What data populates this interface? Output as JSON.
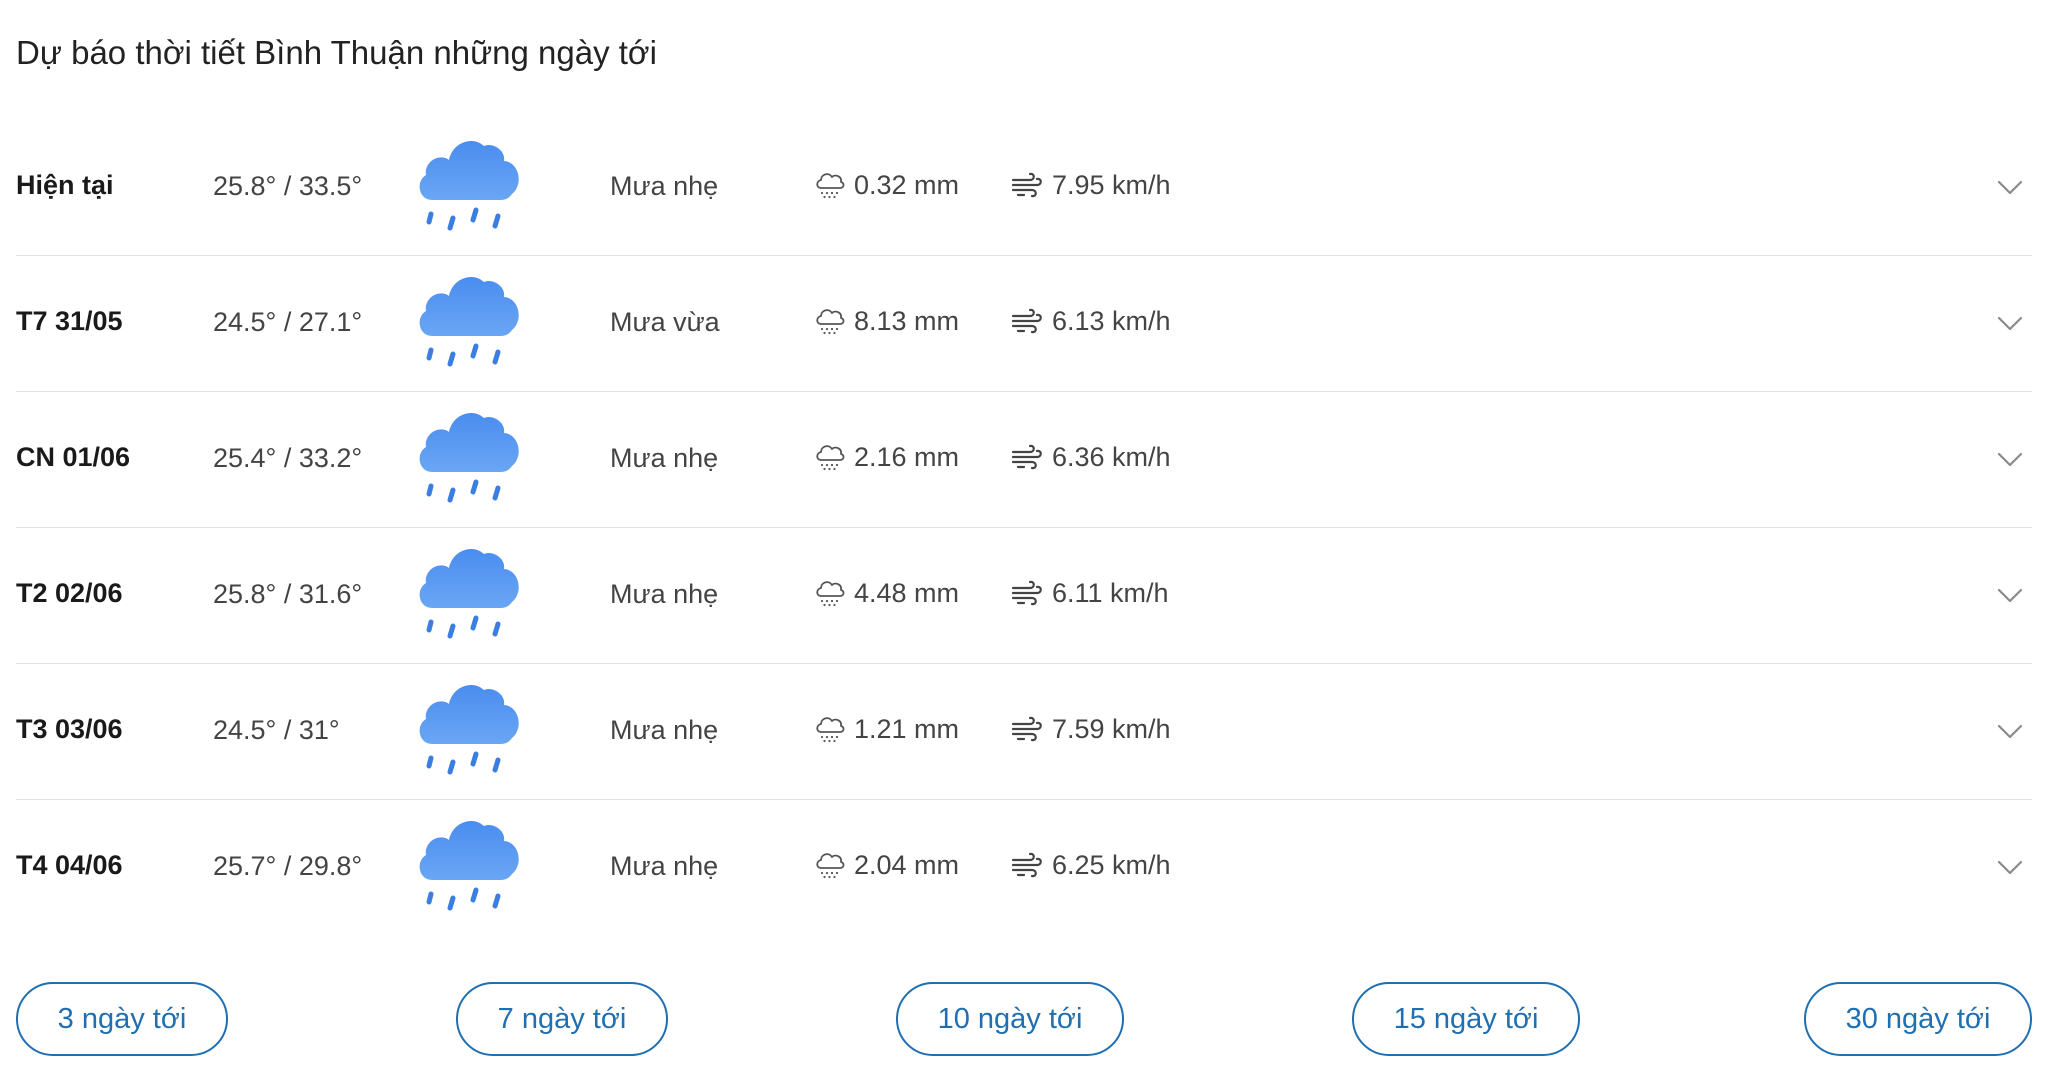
{
  "page": {
    "title": "Dự báo thời tiết Bình Thuận những ngày tới"
  },
  "colors": {
    "accent": "#1f6fb2",
    "cloud": "#5a98f2",
    "rain_drop": "#3b7de0",
    "divider": "#e2e2e2"
  },
  "forecast": [
    {
      "day": "Hiện tại",
      "temp": "25.8° / 33.5°",
      "condition": "Mưa nhẹ",
      "rain": "0.32 mm",
      "wind": "7.95 km/h",
      "icon": "rain-cloud-icon"
    },
    {
      "day": "T7 31/05",
      "temp": "24.5° / 27.1°",
      "condition": "Mưa vừa",
      "rain": "8.13 mm",
      "wind": "6.13 km/h",
      "icon": "rain-cloud-icon"
    },
    {
      "day": "CN 01/06",
      "temp": "25.4° / 33.2°",
      "condition": "Mưa nhẹ",
      "rain": "2.16 mm",
      "wind": "6.36 km/h",
      "icon": "rain-cloud-icon"
    },
    {
      "day": "T2 02/06",
      "temp": "25.8° / 31.6°",
      "condition": "Mưa nhẹ",
      "rain": "4.48 mm",
      "wind": "6.11 km/h",
      "icon": "rain-cloud-icon"
    },
    {
      "day": "T3 03/06",
      "temp": "24.5° / 31°",
      "condition": "Mưa nhẹ",
      "rain": "1.21 mm",
      "wind": "7.59 km/h",
      "icon": "rain-cloud-icon"
    },
    {
      "day": "T4 04/06",
      "temp": "25.7° / 29.8°",
      "condition": "Mưa nhẹ",
      "rain": "2.04 mm",
      "wind": "6.25 km/h",
      "icon": "rain-cloud-icon"
    }
  ],
  "range_buttons": [
    {
      "label": "3 ngày tới"
    },
    {
      "label": "7 ngày tới"
    },
    {
      "label": "10 ngày tới"
    },
    {
      "label": "15 ngày tới"
    },
    {
      "label": "30 ngày tới"
    }
  ]
}
